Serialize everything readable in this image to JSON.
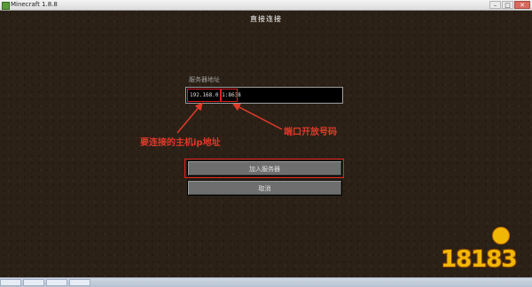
{
  "window": {
    "title": "Minecraft 1.8.8",
    "buttons": [
      "–",
      "□",
      "✕"
    ]
  },
  "screen": {
    "title": "直接连接",
    "field_label": "服务器地址",
    "server_address": "192.168.0.1:8638",
    "join_button": "加入服务器",
    "cancel_button": "取消"
  },
  "annotations": {
    "ip_note": "要连接的主机ip地址",
    "port_note": "端口开放号码"
  },
  "watermark": {
    "text": "18183"
  },
  "colors": {
    "annotation": "#e23a2a",
    "background": "#2b2117",
    "logo": "#f2b705"
  }
}
